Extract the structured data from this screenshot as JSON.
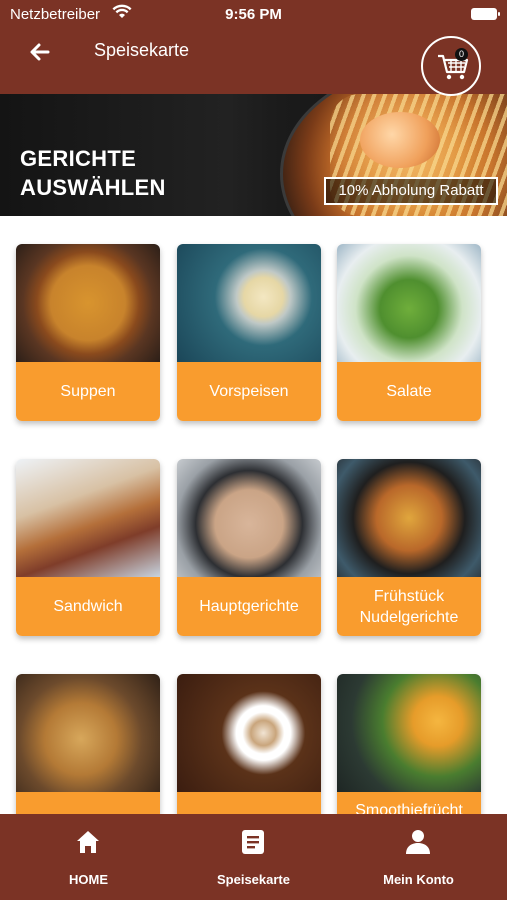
{
  "status_bar": {
    "carrier": "Netzbetreiber",
    "time": "9:56 PM"
  },
  "header": {
    "title": "Speisekarte",
    "cart_count": "0"
  },
  "banner": {
    "headline_line1": "GERICHTE",
    "headline_line2": "AUSWÄHLEN",
    "discount": "10% Abholung Rabatt"
  },
  "categories": [
    {
      "label": "Suppen"
    },
    {
      "label": "Vorspeisen"
    },
    {
      "label": "Salate"
    },
    {
      "label": "Sandwich"
    },
    {
      "label": "Hauptgerichte"
    },
    {
      "label": "Frühstück Nudelgerichte"
    },
    {
      "label": ""
    },
    {
      "label": ""
    },
    {
      "label": "Smoothiefrücht"
    }
  ],
  "tab_bar": {
    "home": "HOME",
    "menu": "Speisekarte",
    "account": "Mein Konto"
  },
  "colors": {
    "brand": "#7b3325",
    "accent": "#f99c2e"
  },
  "icons": {
    "back": "arrow-left-icon",
    "cart": "shopping-cart-icon",
    "home": "home-icon",
    "menu": "menu-list-icon",
    "account": "user-icon"
  }
}
